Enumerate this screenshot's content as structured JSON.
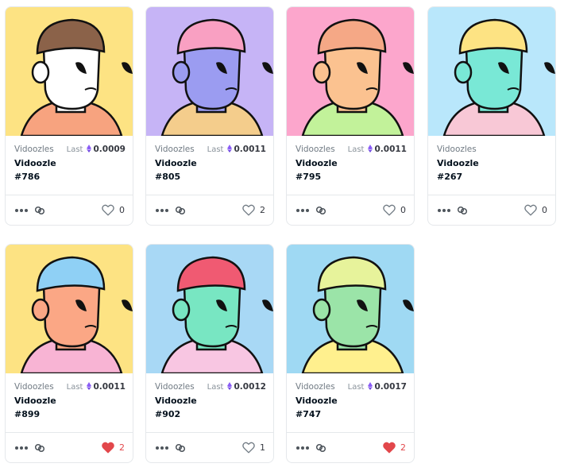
{
  "cards": [
    {
      "collection": "Vidoozles",
      "last_label": "Last",
      "price": "0.0009",
      "name": "Vidoozle",
      "token": "#786",
      "likes": "0",
      "liked": false,
      "colors": {
        "bg": "#fde383",
        "head": "#ffffff",
        "shirt": "#f7a37f",
        "hat": "#8b6249"
      }
    },
    {
      "collection": "Vidoozles",
      "last_label": "Last",
      "price": "0.0011",
      "name": "Vidoozle",
      "token": "#805",
      "likes": "2",
      "liked": false,
      "colors": {
        "bg": "#c6b4f6",
        "head": "#9b9cf1",
        "shirt": "#f4cd8c",
        "hat": "#f9a0c2"
      }
    },
    {
      "collection": "Vidoozles",
      "last_label": "Last",
      "price": "0.0011",
      "name": "Vidoozle",
      "token": "#795",
      "likes": "0",
      "liked": false,
      "colors": {
        "bg": "#fca6cc",
        "head": "#fbc290",
        "shirt": "#c2f29a",
        "hat": "#f5a886"
      }
    },
    {
      "collection": "Vidoozles",
      "last_label": "Last",
      "price": "",
      "name": "Vidoozle",
      "token": "#267",
      "likes": "0",
      "liked": false,
      "colors": {
        "bg": "#b9e7fb",
        "head": "#79e8d6",
        "shirt": "#f8c8d6",
        "hat": "#fde383"
      }
    },
    {
      "collection": "Vidoozles",
      "last_label": "Last",
      "price": "0.0011",
      "name": "Vidoozle",
      "token": "#899",
      "likes": "2",
      "liked": true,
      "colors": {
        "bg": "#fde383",
        "head": "#fba785",
        "shirt": "#f8b4d4",
        "hat": "#8fd0f5"
      }
    },
    {
      "collection": "Vidoozles",
      "last_label": "Last",
      "price": "0.0012",
      "name": "Vidoozle",
      "token": "#902",
      "likes": "1",
      "liked": false,
      "colors": {
        "bg": "#a8d8f5",
        "head": "#78e6c2",
        "shirt": "#f8c6e2",
        "hat": "#f05a72"
      }
    },
    {
      "collection": "Vidoozles",
      "last_label": "Last",
      "price": "0.0017",
      "name": "Vidoozle",
      "token": "#747",
      "likes": "2",
      "liked": true,
      "colors": {
        "bg": "#9fd9f3",
        "head": "#9be4a8",
        "shirt": "#fff08e",
        "hat": "#e7f39b"
      }
    }
  ],
  "icons": {
    "more": "more-options-icon",
    "chain": "chain-link-icon",
    "like": "heart-icon",
    "currency": "eth-icon"
  },
  "accent": {
    "liked": "#e2474b",
    "eth": "#8a5cf6"
  }
}
